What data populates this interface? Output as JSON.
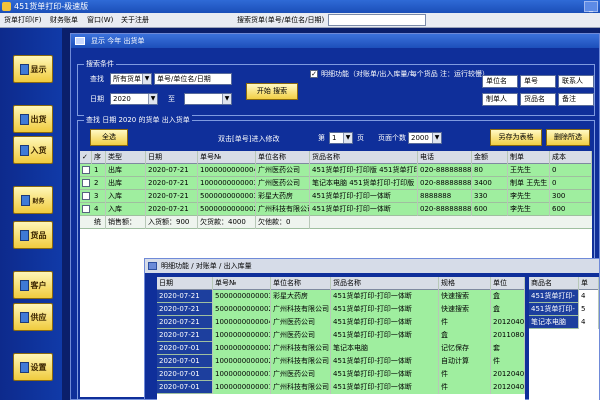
{
  "app": {
    "title": "451货单打印-极速版",
    "minimize": "_"
  },
  "menu": {
    "items": [
      "货单打印(F)",
      "财务账单",
      "窗口(W)",
      "关于注册"
    ],
    "search_label": "搜索货单(单号/单位名/日期)",
    "search_value": ""
  },
  "sidebar": {
    "items": [
      "显示",
      "出货",
      "入货",
      "财务",
      "货品",
      "客户",
      "供应",
      "设置"
    ],
    "finance_small": "财务\n报表"
  },
  "main_window": {
    "title": "显示 今年 出货单",
    "search_group": "搜索条件",
    "find_label": "查找",
    "find_type": "所有货单",
    "find_text": "单号/单位名/日期",
    "date_label": "日期",
    "year": "2020",
    "to_label": "至",
    "year_to": "",
    "start_search": "开始 搜索",
    "detail_check": "✓",
    "detail_label": "明细功能（对账单/出入库量/每个货品 注：运行较慢）",
    "filter_tags": [
      "单位名",
      "单号",
      "联系人",
      "制单人",
      "货品名",
      "备注"
    ],
    "list_group": "查找 日期 2020 的货单 出入货单",
    "select_all": "全选",
    "dblclick_hint": "双击[单号]进入修改",
    "page_prefix": "第",
    "page_value": "1",
    "page_suffix": "页",
    "page_size_label": "页面个数",
    "page_size": "2000",
    "save_excel": "另存为表格",
    "delete_selected": "删除所选"
  },
  "main_table": {
    "headers": [
      "✓",
      "序",
      "类型",
      "日期",
      "单号№",
      "单位名称",
      "货品名称",
      "电话",
      "金额",
      "制单",
      "成本"
    ],
    "rows": [
      [
        "",
        "1",
        "出库",
        "2020-07-21",
        "1000000000004",
        "广州医药公司",
        "451货单打印-打印版 451货单打印-打印版",
        "020-88888888",
        "80",
        "王先生",
        "0"
      ],
      [
        "",
        "2",
        "出库",
        "2020-07-21",
        "1000000000003",
        "广州医药公司",
        "笔记本电脑 451货单打印-打印版",
        "020-88888888",
        "3400",
        "制单 王先生",
        "0"
      ],
      [
        "",
        "3",
        "入库",
        "2020-07-21",
        "5000000000003",
        "彩星大药房",
        "451货单打印-打印一体断",
        "8888888",
        "330",
        "李先生",
        "300"
      ],
      [
        "",
        "4",
        "入库",
        "2020-07-21",
        "5000000000002",
        "广州科技有限公司",
        "451货单打印-打印一体断",
        "020-88888888",
        "600",
        "李先生",
        "600"
      ]
    ],
    "summary": [
      "统",
      "销售额：",
      "入货额：900",
      "欠货款：4000",
      "欠他款：0"
    ]
  },
  "detail_window": {
    "title": "明细功能 / 对账单 / 出入库量",
    "headers": [
      "日期",
      "单号№",
      "单位名称",
      "货品名称",
      "规格",
      "单位"
    ],
    "rows": [
      [
        "2020-07-21",
        "5000000000003",
        "彩星大药房",
        "451货单打印-打印一体断",
        "快速搜索",
        "盒"
      ],
      [
        "2020-07-21",
        "5000000000002",
        "广州科技有限公司",
        "451货单打印-打印一体断",
        "快速搜索",
        "盒"
      ],
      [
        "2020-07-21",
        "1000000000004",
        "广州医药公司",
        "451货单打印-打印一体断",
        "件",
        "20120402"
      ],
      [
        "2020-07-21",
        "1000000000003",
        "广州医药公司",
        "451货单打印-打印一体断",
        "盒",
        "20110809"
      ],
      [
        "2020-07-01",
        "1000000000002",
        "广州科技有限公司",
        "笔记本电脑",
        "记忆保存",
        "套"
      ],
      [
        "2020-07-01",
        "1000000000002",
        "广州科技有限公司",
        "451货单打印-打印一体断",
        "自动计算",
        "件"
      ],
      [
        "2020-07-01",
        "1000000000001",
        "广州医药公司",
        "451货单打印-打印一体断",
        "件",
        "20120402"
      ],
      [
        "2020-07-01",
        "1000000000001",
        "广州科技有限公司",
        "451货单打印-打印一体断",
        "件",
        "20120402"
      ]
    ],
    "side_headers": [
      "商品名",
      "单"
    ],
    "side_rows": [
      [
        "451货单打印-",
        "4"
      ],
      [
        "451货单打印-",
        "5"
      ],
      [
        "笔记本电脑",
        "4"
      ]
    ]
  },
  "colors": {
    "accent": "#f2cf45",
    "row_green": "#9fee9f",
    "row_blue": "#1d3f9e"
  }
}
